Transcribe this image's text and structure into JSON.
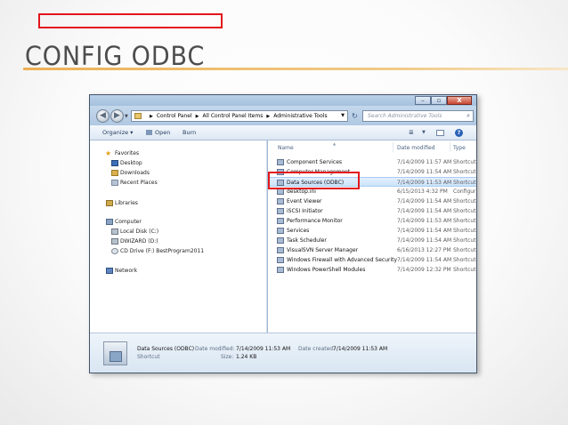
{
  "slide": {
    "title": "CONFIG ODBC"
  },
  "window": {
    "buttons": {
      "minimize": "–",
      "maximize": "▫",
      "close": "X"
    },
    "nav": {
      "back": "◀",
      "forward": "▶",
      "history": "▼"
    },
    "address": {
      "crumbs": [
        "Control Panel",
        "All Control Panel Items",
        "Administrative Tools"
      ],
      "separator": "▶",
      "dropdown": "▼"
    },
    "refresh": "↻",
    "search": {
      "placeholder": "Search Administrative Tools",
      "icon": "⌕"
    },
    "toolbar": {
      "organize": "Organize ▾",
      "open": "Open",
      "burn": "Burn",
      "views_icon": "≣",
      "views_drop": "▼",
      "help": "?"
    },
    "navpane": {
      "favorites": "Favorites",
      "desktop": "Desktop",
      "downloads": "Downloads",
      "recent": "Recent Places",
      "libraries": "Libraries",
      "computer": "Computer",
      "local_disk": "Local Disk (C:)",
      "dwizard": "DWIZARD (D:)",
      "cd_drive": "CD Drive (F:) BestProgram2011",
      "network": "Network"
    },
    "columns": {
      "name": "Name",
      "date": "Date modified",
      "type": "Type"
    },
    "files": [
      {
        "name": "Component Services",
        "date": "7/14/2009 11:57 AM",
        "type": "Shortcut"
      },
      {
        "name": "Computer Management",
        "date": "7/14/2009 11:54 AM",
        "type": "Shortcut"
      },
      {
        "name": "Data Sources (ODBC)",
        "date": "7/14/2009 11:53 AM",
        "type": "Shortcut"
      },
      {
        "name": "desktop.ini",
        "date": "6/15/2013 4:32 PM",
        "type": "Configur"
      },
      {
        "name": "Event Viewer",
        "date": "7/14/2009 11:54 AM",
        "type": "Shortcut"
      },
      {
        "name": "iSCSI Initiator",
        "date": "7/14/2009 11:54 AM",
        "type": "Shortcut"
      },
      {
        "name": "Performance Monitor",
        "date": "7/14/2009 11:53 AM",
        "type": "Shortcut"
      },
      {
        "name": "Services",
        "date": "7/14/2009 11:54 AM",
        "type": "Shortcut"
      },
      {
        "name": "Task Scheduler",
        "date": "7/14/2009 11:54 AM",
        "type": "Shortcut"
      },
      {
        "name": "VisualSVN Server Manager",
        "date": "6/16/2013 12:27 PM",
        "type": "Shortcut"
      },
      {
        "name": "Windows Firewall with Advanced Security",
        "date": "7/14/2009 11:54 AM",
        "type": "Shortcut"
      },
      {
        "name": "Windows PowerShell Modules",
        "date": "7/14/2009 12:32 PM",
        "type": "Shortcut"
      }
    ],
    "details": {
      "name": "Data Sources (ODBC)",
      "kind": "Shortcut",
      "modified_label": "Date modified:",
      "modified_value": "7/14/2009 11:53 AM",
      "created_label": "Date created:",
      "created_value": "7/14/2009 11:53 AM",
      "size_label": "Size:",
      "size_value": "1.24 KB"
    }
  }
}
